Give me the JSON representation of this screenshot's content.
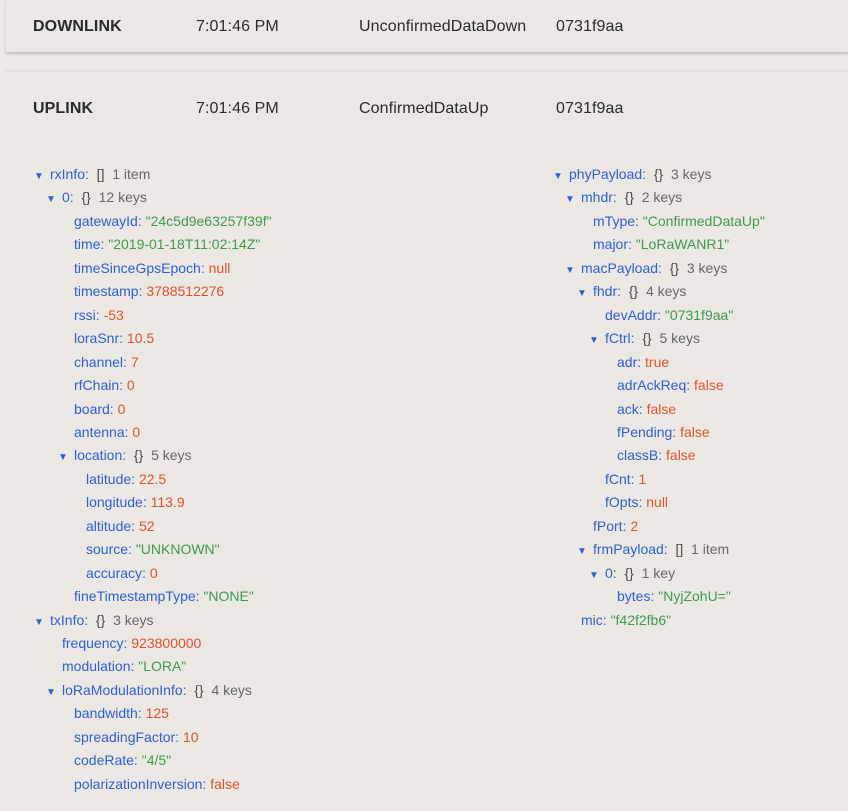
{
  "rows": [
    {
      "type": "DOWNLINK",
      "time": "7:01:46 PM",
      "mtype": "UnconfirmedDataDown",
      "dev": "0731f9aa"
    },
    {
      "type": "UPLINK",
      "time": "7:01:46 PM",
      "mtype": "ConfirmedDataUp",
      "dev": "0731f9aa"
    }
  ],
  "left_tree": [
    {
      "d": 0,
      "arrow": true,
      "key": "rxInfo:",
      "br": "[]",
      "cnt": "1 item"
    },
    {
      "d": 1,
      "arrow": true,
      "key": "0:",
      "br": "{}",
      "cnt": "12 keys"
    },
    {
      "d": 2,
      "key": "gatewayId:",
      "val": "\"24c5d9e63257f39f\"",
      "vt": "s"
    },
    {
      "d": 2,
      "key": "time:",
      "val": "\"2019-01-18T11:02:14Z\"",
      "vt": "s"
    },
    {
      "d": 2,
      "key": "timeSinceGpsEpoch:",
      "val": "null",
      "vt": "n"
    },
    {
      "d": 2,
      "key": "timestamp:",
      "val": "3788512276",
      "vt": "n"
    },
    {
      "d": 2,
      "key": "rssi:",
      "val": "-53",
      "vt": "n"
    },
    {
      "d": 2,
      "key": "loraSnr:",
      "val": "10.5",
      "vt": "n"
    },
    {
      "d": 2,
      "key": "channel:",
      "val": "7",
      "vt": "n"
    },
    {
      "d": 2,
      "key": "rfChain:",
      "val": "0",
      "vt": "n"
    },
    {
      "d": 2,
      "key": "board:",
      "val": "0",
      "vt": "n"
    },
    {
      "d": 2,
      "key": "antenna:",
      "val": "0",
      "vt": "n"
    },
    {
      "d": 2,
      "arrow": true,
      "key": "location:",
      "br": "{}",
      "cnt": "5 keys"
    },
    {
      "d": 3,
      "key": "latitude:",
      "val": "22.5",
      "vt": "n"
    },
    {
      "d": 3,
      "key": "longitude:",
      "val": "113.9",
      "vt": "n"
    },
    {
      "d": 3,
      "key": "altitude:",
      "val": "52",
      "vt": "n"
    },
    {
      "d": 3,
      "key": "source:",
      "val": "\"UNKNOWN\"",
      "vt": "s"
    },
    {
      "d": 3,
      "key": "accuracy:",
      "val": "0",
      "vt": "n"
    },
    {
      "d": 2,
      "key": "fineTimestampType:",
      "val": "\"NONE\"",
      "vt": "s"
    },
    {
      "d": 0,
      "arrow": true,
      "key": "txInfo:",
      "br": "{}",
      "cnt": "3 keys"
    },
    {
      "d": 1,
      "key": "frequency:",
      "val": "923800000",
      "vt": "n"
    },
    {
      "d": 1,
      "key": "modulation:",
      "val": "\"LORA\"",
      "vt": "s"
    },
    {
      "d": 1,
      "arrow": true,
      "key": "loRaModulationInfo:",
      "br": "{}",
      "cnt": "4 keys"
    },
    {
      "d": 2,
      "key": "bandwidth:",
      "val": "125",
      "vt": "n"
    },
    {
      "d": 2,
      "key": "spreadingFactor:",
      "val": "10",
      "vt": "n"
    },
    {
      "d": 2,
      "key": "codeRate:",
      "val": "\"4/5\"",
      "vt": "s"
    },
    {
      "d": 2,
      "key": "polarizationInversion:",
      "val": "false",
      "vt": "b"
    }
  ],
  "right_tree": [
    {
      "d": 0,
      "arrow": true,
      "key": "phyPayload:",
      "br": "{}",
      "cnt": "3 keys"
    },
    {
      "d": 1,
      "arrow": true,
      "key": "mhdr:",
      "br": "{}",
      "cnt": "2 keys"
    },
    {
      "d": 2,
      "key": "mType:",
      "val": "\"ConfirmedDataUp\"",
      "vt": "s"
    },
    {
      "d": 2,
      "key": "major:",
      "val": "\"LoRaWANR1\"",
      "vt": "s"
    },
    {
      "d": 1,
      "arrow": true,
      "key": "macPayload:",
      "br": "{}",
      "cnt": "3 keys"
    },
    {
      "d": 2,
      "arrow": true,
      "key": "fhdr:",
      "br": "{}",
      "cnt": "4 keys"
    },
    {
      "d": 3,
      "key": "devAddr:",
      "val": "\"0731f9aa\"",
      "vt": "s"
    },
    {
      "d": 3,
      "arrow": true,
      "key": "fCtrl:",
      "br": "{}",
      "cnt": "5 keys"
    },
    {
      "d": 4,
      "key": "adr:",
      "val": "true",
      "vt": "b"
    },
    {
      "d": 4,
      "key": "adrAckReq:",
      "val": "false",
      "vt": "b"
    },
    {
      "d": 4,
      "key": "ack:",
      "val": "false",
      "vt": "b"
    },
    {
      "d": 4,
      "key": "fPending:",
      "val": "false",
      "vt": "b"
    },
    {
      "d": 4,
      "key": "classB:",
      "val": "false",
      "vt": "b"
    },
    {
      "d": 3,
      "key": "fCnt:",
      "val": "1",
      "vt": "n"
    },
    {
      "d": 3,
      "key": "fOpts:",
      "val": "null",
      "vt": "n"
    },
    {
      "d": 2,
      "key": "fPort:",
      "val": "2",
      "vt": "n"
    },
    {
      "d": 2,
      "arrow": true,
      "key": "frmPayload:",
      "br": "[]",
      "cnt": "1 item"
    },
    {
      "d": 3,
      "arrow": true,
      "key": "0:",
      "br": "{}",
      "cnt": "1 key"
    },
    {
      "d": 4,
      "key": "bytes:",
      "val": "\"NyjZohU=\"",
      "vt": "s"
    },
    {
      "d": 1,
      "key": "mic:",
      "val": "\"f42f2fb6\"",
      "vt": "s"
    }
  ],
  "arrow_glyph": "▼"
}
